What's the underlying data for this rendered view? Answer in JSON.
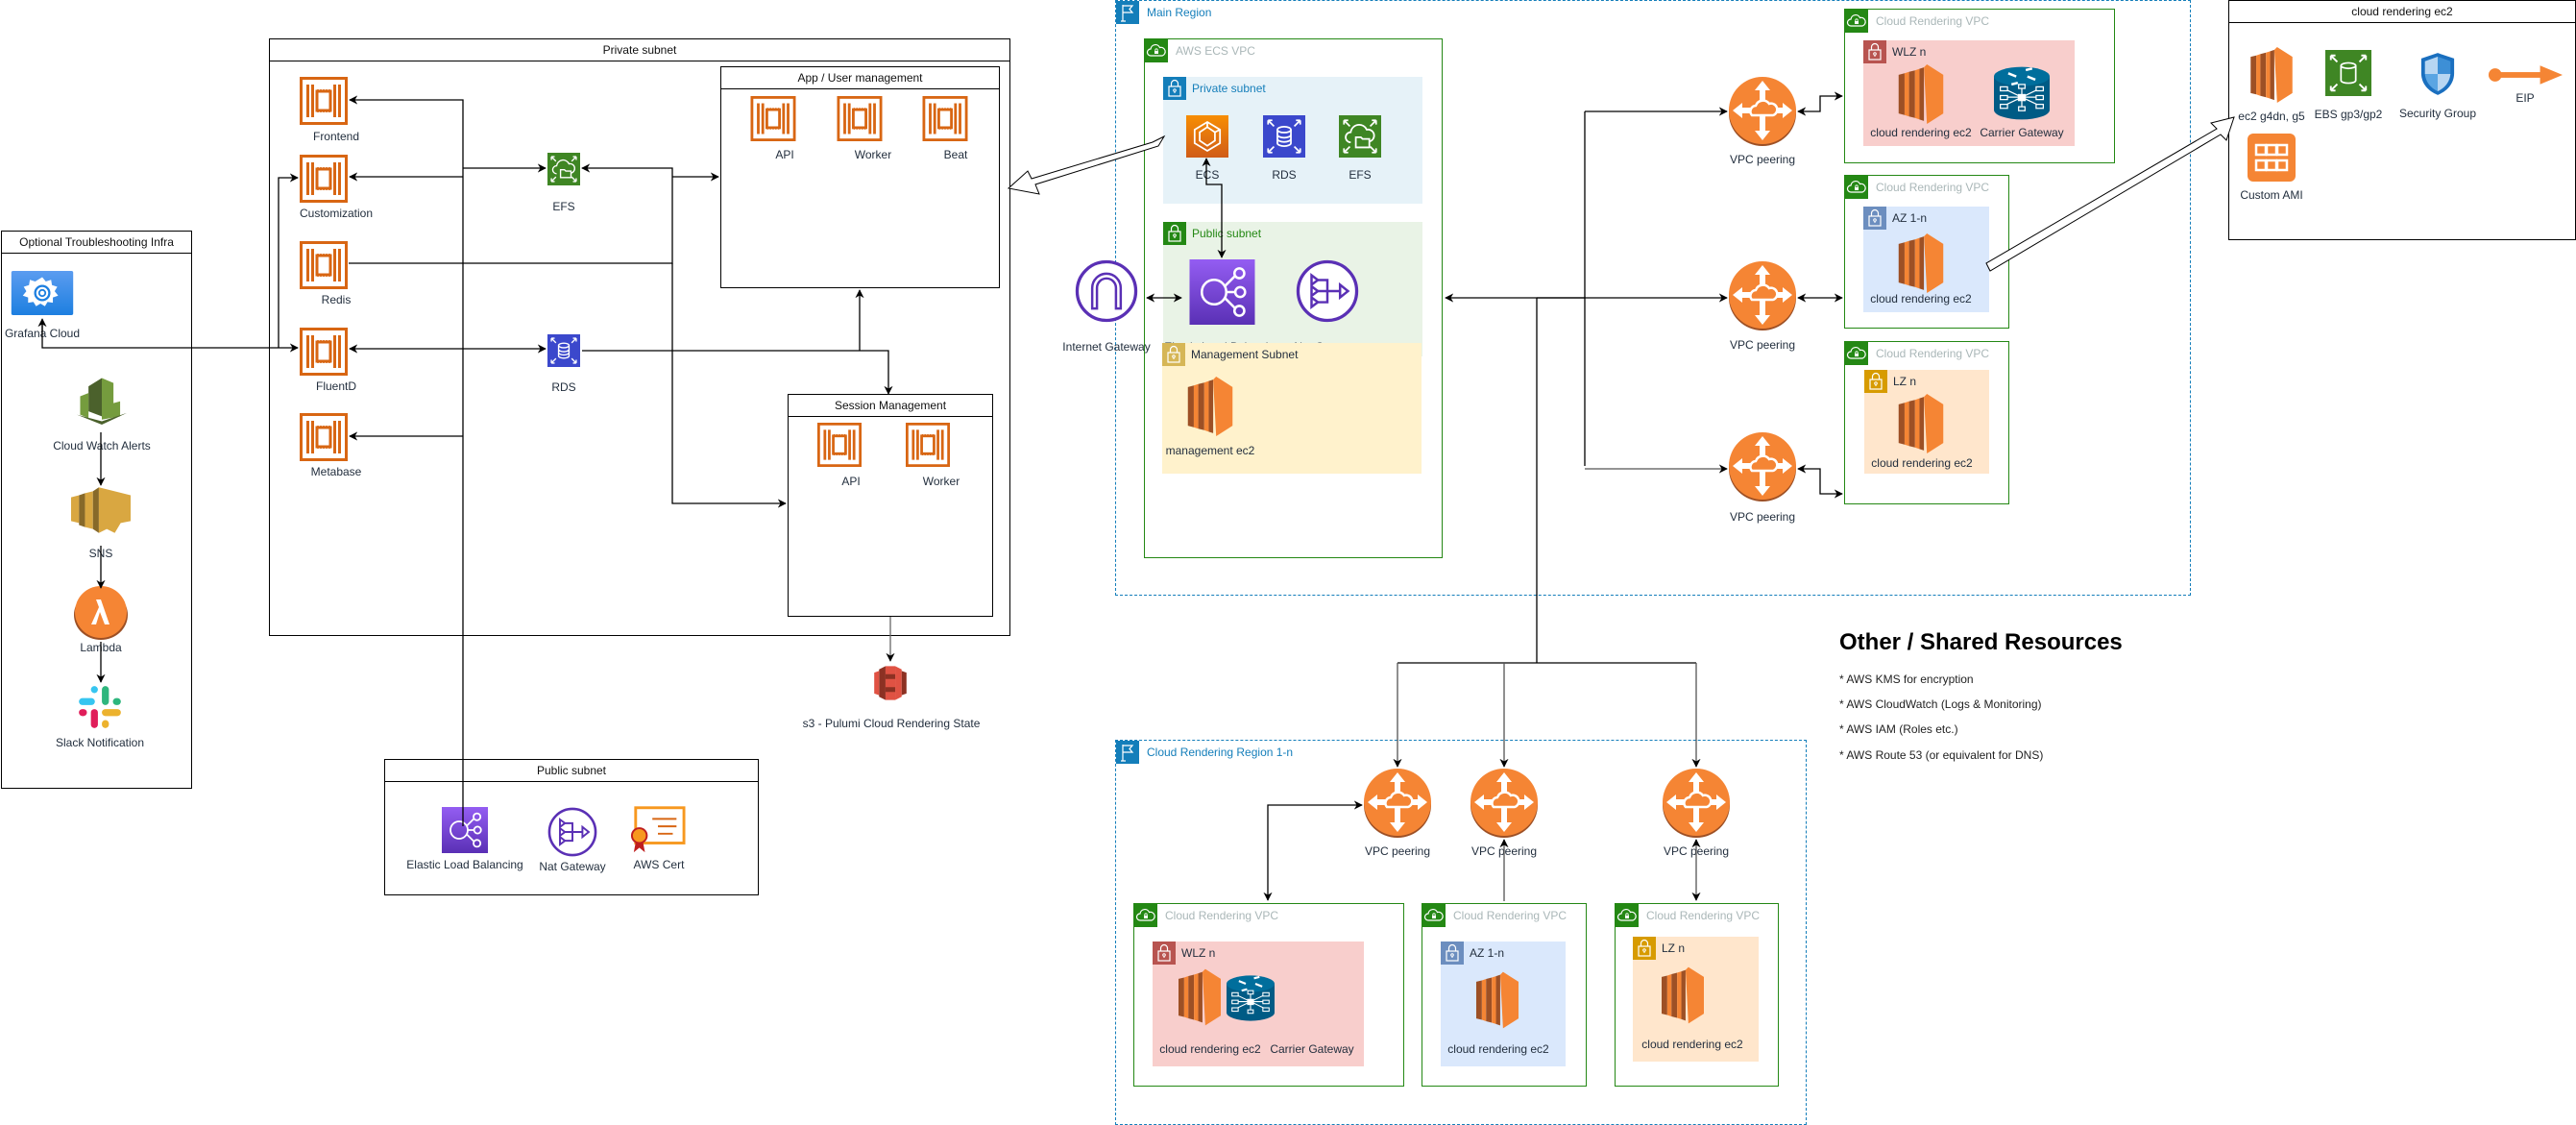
{
  "troubleshooting": {
    "title": "Optional Troubleshooting Infra",
    "items": {
      "grafana": "Grafana Cloud",
      "cloudwatch": "Cloud Watch Alerts",
      "sns": "SNS",
      "lambda": "Lambda",
      "slack": "Slack Notification"
    }
  },
  "private_subnet": {
    "title": "Private subnet",
    "services": [
      "Frontend",
      "Customization",
      "Redis",
      "FluentD",
      "Metabase"
    ],
    "efs": "EFS",
    "rds": "RDS",
    "app_mgmt": {
      "title": "App / User management",
      "items": [
        "API",
        "Worker",
        "Beat"
      ]
    },
    "session_mgmt": {
      "title": "Session Management",
      "items": [
        "API",
        "Worker"
      ]
    }
  },
  "s3": "s3 - Pulumi Cloud Rendering State",
  "public_subnet": {
    "title": "Public subnet",
    "items": [
      "Elastic Load Balancing",
      "Nat Gateway",
      "AWS Cert"
    ]
  },
  "main_region": {
    "title": "Main Region",
    "vpc_title": "AWS ECS VPC",
    "private_subnet": {
      "title": "Private subnet",
      "items": [
        "ECS",
        "RDS",
        "EFS"
      ]
    },
    "public_subnet": {
      "title": "Public subnet",
      "items": [
        "Elastic Load Balancing",
        "Nat Gateway"
      ]
    },
    "management_subnet": {
      "title": "Management Subnet",
      "item": "management ec2"
    },
    "internet_gateway": "Internet Gateway",
    "peerings": [
      "VPC peering",
      "VPC peering",
      "VPC peering"
    ],
    "rendering_vpcs": [
      {
        "title": "Cloud Rendering VPC",
        "zone": "WLZ n",
        "items": [
          "cloud rendering ec2",
          "Carrier Gateway"
        ]
      },
      {
        "title": "Cloud Rendering VPC",
        "zone": "AZ 1-n",
        "items": [
          "cloud rendering ec2"
        ]
      },
      {
        "title": "Cloud Rendering VPC",
        "zone": "LZ n",
        "items": [
          "cloud rendering ec2"
        ]
      }
    ]
  },
  "ec2_detail": {
    "title": "cloud rendering ec2",
    "items": [
      "ec2 g4dn, g5",
      "EBS gp3/gp2",
      "Security Group",
      "EIP",
      "Custom AMI"
    ]
  },
  "shared": {
    "title": "Other / Shared Resources",
    "items": [
      "* AWS KMS for encryption",
      "* AWS CloudWatch (Logs & Monitoring)",
      "* AWS IAM (Roles etc.)",
      "* AWS Route 53 (or equivalent for DNS)"
    ]
  },
  "rendering_region": {
    "title": "Cloud Rendering Region 1-n",
    "peerings": [
      "VPC peering",
      "VPC peering",
      "VPC peering"
    ],
    "rendering_vpcs": [
      {
        "title": "Cloud Rendering VPC",
        "zone": "WLZ n",
        "items": [
          "cloud rendering ec2",
          "Carrier Gateway"
        ]
      },
      {
        "title": "Cloud Rendering VPC",
        "zone": "AZ 1-n",
        "items": [
          "cloud rendering ec2"
        ]
      },
      {
        "title": "Cloud Rendering VPC",
        "zone": "LZ n",
        "items": [
          "cloud rendering ec2"
        ]
      }
    ]
  },
  "colors": {
    "region_blue": "#147eba",
    "vpc_green": "#248814",
    "ec2_orange": "#f58534",
    "container_orange": "#d86613",
    "wlz_bg": "#f8cecc",
    "az_bg": "#dae8fc",
    "lz_bg": "#ffe6cc",
    "mgmt_bg": "#fff2cc",
    "private_bg": "#e6f2f8",
    "public_bg": "#e9f3e6"
  }
}
